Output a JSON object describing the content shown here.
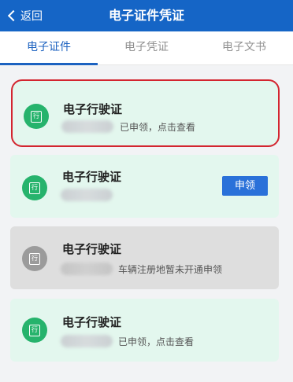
{
  "header": {
    "back_label": "返回",
    "title": "电子证件凭证"
  },
  "tabs": [
    {
      "label": "电子证件",
      "active": true
    },
    {
      "label": "电子凭证",
      "active": false
    },
    {
      "label": "电子文书",
      "active": false
    }
  ],
  "cards": [
    {
      "title": "电子行驶证",
      "icon_glyph": "行",
      "status": "已申领，点击查看",
      "state": "highlighted"
    },
    {
      "title": "电子行驶证",
      "icon_glyph": "行",
      "status": "",
      "button_label": "申领",
      "state": "normal"
    },
    {
      "title": "电子行驶证",
      "icon_glyph": "行",
      "status": "车辆注册地暂未开通申领",
      "state": "disabled"
    },
    {
      "title": "电子行驶证",
      "icon_glyph": "行",
      "status": "已申领，点击查看",
      "state": "normal"
    }
  ],
  "colors": {
    "header_bg": "#1565c6",
    "active_tab": "#1c62c0",
    "card_bg": "#e3f7ee",
    "card_disabled_bg": "#dedede",
    "icon_green": "#26b36c",
    "highlight_border": "#d3252f",
    "button_bg": "#2a71d9"
  }
}
